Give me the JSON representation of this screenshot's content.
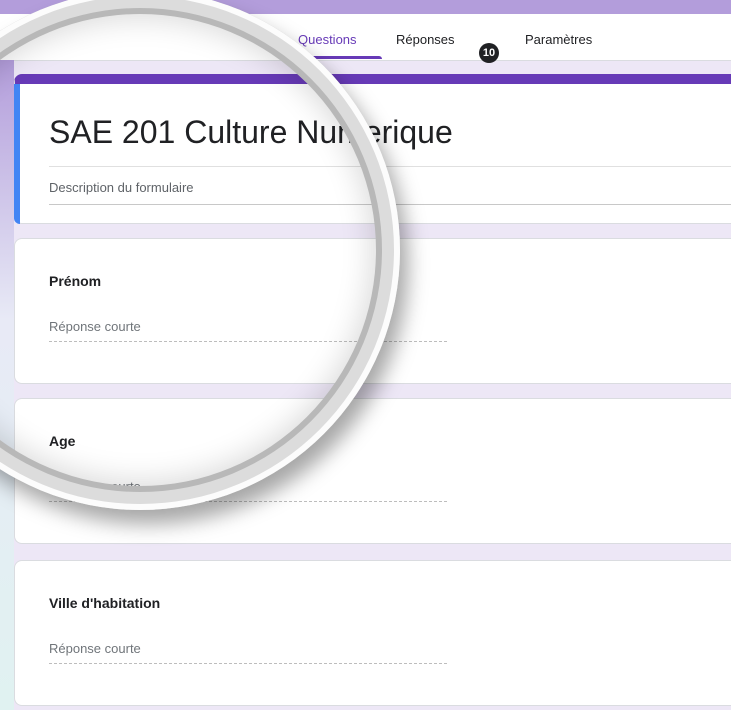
{
  "tabs": [
    {
      "label": "Questions",
      "active": true
    },
    {
      "label": "Réponses",
      "badge": "10"
    },
    {
      "label": "Paramètres"
    }
  ],
  "form": {
    "title": "SAE 201 Culture Numerique",
    "description_placeholder": "Description du formulaire"
  },
  "questions": [
    {
      "title": "Prénom",
      "placeholder": "Réponse courte"
    },
    {
      "title": "Age",
      "placeholder": "Réponse courte"
    },
    {
      "title": "Ville d'habitation",
      "placeholder": "Réponse courte"
    }
  ],
  "colors": {
    "accent": "#673ab7",
    "focus_bar": "#4285f4",
    "background": "#ede7f6"
  }
}
